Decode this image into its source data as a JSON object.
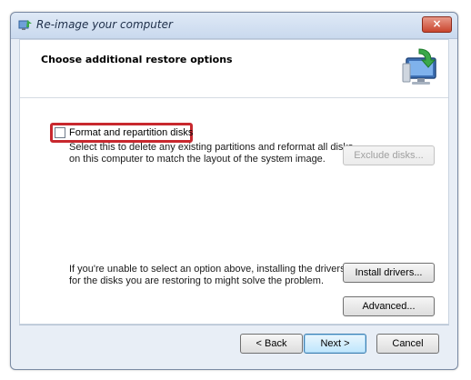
{
  "window": {
    "title": "Re-image your computer",
    "close_label": "×"
  },
  "header": {
    "title": "Choose additional restore options",
    "image_icon": "monitor-restore-icon"
  },
  "format_option": {
    "label": "Format and repartition disks",
    "checked": false,
    "description": [
      "Select this to delete any existing partitions and reformat all disks",
      "on this computer to match the layout of the system image."
    ],
    "exclude_button": "Exclude disks...",
    "exclude_enabled": false
  },
  "drivers": {
    "description": [
      "If you're unable to select an option above, installing the drivers",
      "for the disks you are restoring to might solve the problem."
    ],
    "install_button": "Install drivers...",
    "advanced_button": "Advanced..."
  },
  "footer": {
    "back_button": "< Back",
    "next_button": "Next >",
    "cancel_button": "Cancel"
  },
  "colors": {
    "highlight": "#c8282e",
    "accent": "#3c7fb1"
  }
}
